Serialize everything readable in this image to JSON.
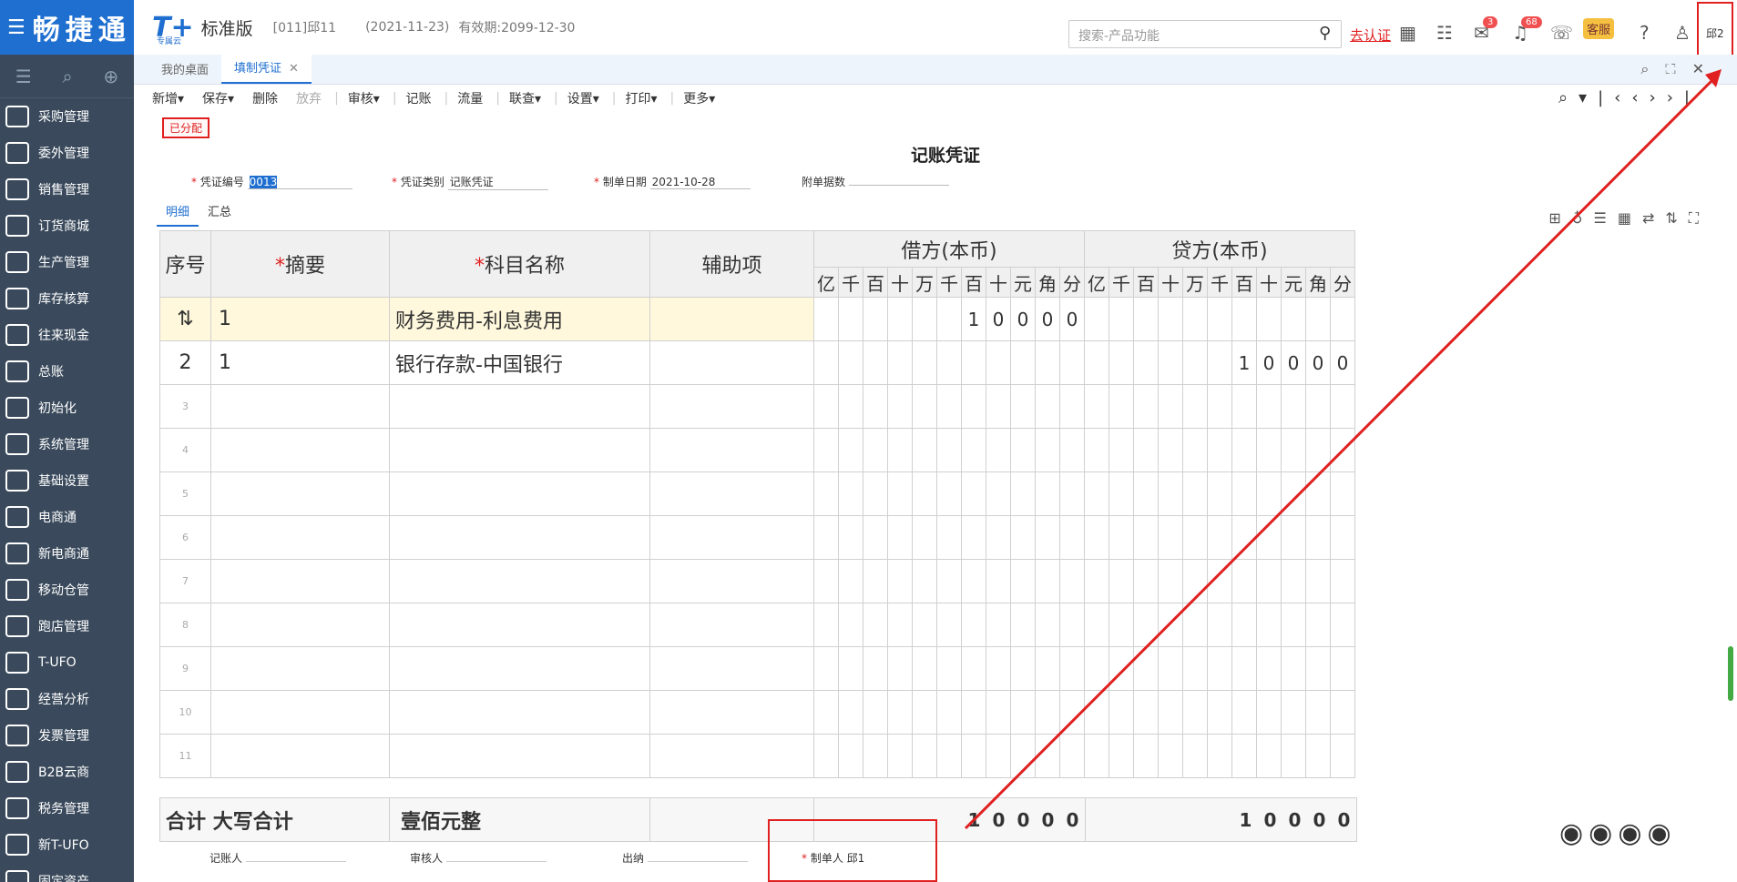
{
  "brand": "畅捷通",
  "sidebar": {
    "items": [
      {
        "label": "采购管理"
      },
      {
        "label": "委外管理"
      },
      {
        "label": "销售管理"
      },
      {
        "label": "订货商城"
      },
      {
        "label": "生产管理"
      },
      {
        "label": "库存核算"
      },
      {
        "label": "往来现金"
      },
      {
        "label": "总账"
      },
      {
        "label": "初始化"
      },
      {
        "label": "系统管理"
      },
      {
        "label": "基础设置"
      },
      {
        "label": "电商通"
      },
      {
        "label": "新电商通"
      },
      {
        "label": "移动仓管"
      },
      {
        "label": "跑店管理"
      },
      {
        "label": "T-UFO"
      },
      {
        "label": "经营分析"
      },
      {
        "label": "发票管理"
      },
      {
        "label": "B2B云商"
      },
      {
        "label": "税务管理"
      },
      {
        "label": "新T-UFO"
      },
      {
        "label": "固定资产"
      }
    ]
  },
  "header": {
    "logo": "T+",
    "logo_sub": "专属云",
    "edition": "标准版",
    "account": "[011]邱11",
    "date": "(2021-11-23)",
    "valid": "有效期:2099-12-30",
    "search_placeholder": "搜索-产品功能",
    "cert": "去认证",
    "badge_msg": "3",
    "badge_notify": "68",
    "user": "邱2",
    "mascot_label": "客服"
  },
  "tabs": [
    {
      "label": "我的桌面"
    },
    {
      "label": "填制凭证"
    }
  ],
  "toolbar": {
    "new": "新增",
    "save": "保存",
    "delete": "删除",
    "abandon": "放弃",
    "audit": "审核",
    "post": "记账",
    "flow": "流量",
    "link": "联查",
    "settings": "设置",
    "print": "打印",
    "more": "更多"
  },
  "voucher": {
    "status": "已分配",
    "title": "记账凭证",
    "no_label": "凭证编号",
    "no": "0013",
    "type_label": "凭证类别",
    "type": "记账凭证",
    "date_label": "制单日期",
    "date": "2021-10-28",
    "attach_label": "附单据数",
    "subtab_detail": "明细",
    "subtab_summary": "汇总",
    "col_seq": "序号",
    "col_summary": "摘要",
    "col_account": "科目名称",
    "col_aux": "辅助项",
    "col_debit": "借方(本币)",
    "col_credit": "贷方(本币)",
    "digits": [
      "亿",
      "千",
      "百",
      "十",
      "万",
      "千",
      "百",
      "十",
      "元",
      "角",
      "分"
    ],
    "rows": [
      {
        "seq": "",
        "summary": "1",
        "account": "财务费用-利息费用",
        "debit": "10000",
        "credit": ""
      },
      {
        "seq": "2",
        "summary": "1",
        "account": "银行存款-中国银行",
        "debit": "",
        "credit": "10000"
      }
    ],
    "empty_rows": [
      "3",
      "4",
      "5",
      "6",
      "7",
      "8",
      "9",
      "10",
      "11"
    ],
    "total_label": "合计",
    "total_caps_label": "大写合计",
    "total_caps": "壹佰元整",
    "total_debit": "10000",
    "total_credit": "10000",
    "sign_bookkeeper": "记账人",
    "sign_auditor": "审核人",
    "sign_cashier": "出纳",
    "sign_maker": "制单人",
    "maker": "邱1"
  }
}
